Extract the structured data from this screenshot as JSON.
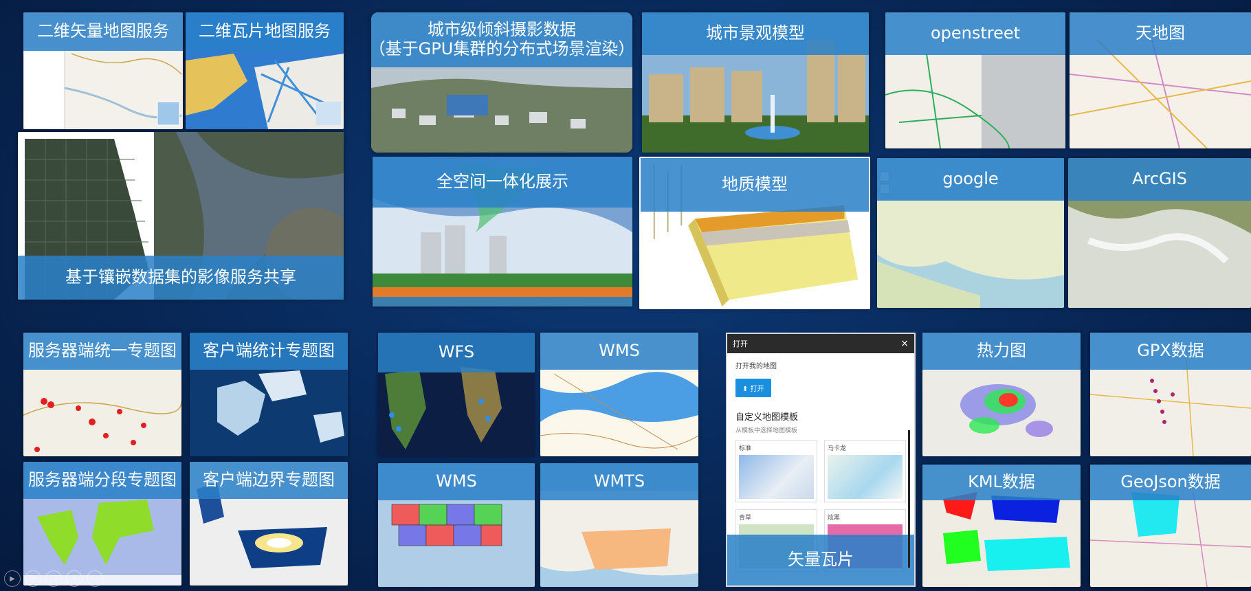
{
  "tiles": {
    "vector2d": "二维矢量地图服务",
    "tile2d": "二维瓦片地图服务",
    "mosaic": "基于镶嵌数据集的影像服务共享",
    "oblique_line1": "城市级倾斜摄影数据",
    "oblique_line2": "（基于GPU集群的分布式场景渲染）",
    "landscape": "城市景观模型",
    "openstreet": "openstreet",
    "tianditu": "天地图",
    "fullspace": "全空间一体化展示",
    "geology": "地质模型",
    "google": "google",
    "arcgis": "ArcGIS",
    "server_unified": "服务器端统一专题图",
    "client_stat": "客户端统计专题图",
    "wfs": "WFS",
    "wms_a": "WMS",
    "server_segment": "服务器端分段专题图",
    "client_border": "客户端边界专题图",
    "wms_b": "WMS",
    "wmts": "WMTS",
    "vector_tile": "矢量瓦片",
    "heatmap": "热力图",
    "gpx": "GPX数据",
    "kml": "KML数据",
    "geojson": "GeoJson数据"
  },
  "dialog": {
    "title": "打开",
    "close": "×",
    "recent": "打开我的地图",
    "open_btn": "打开",
    "template_title": "自定义地图模板",
    "template_hint": "从模板中选择地图模板",
    "card1": "标准",
    "card2": "马卡龙",
    "card3": "青草",
    "card4": "炫黑"
  },
  "icons": {
    "player": [
      "play-icon",
      "pen-icon",
      "copy-icon",
      "zoom-icon",
      "more-icon"
    ]
  },
  "colors": {
    "banner": "#2a80c8",
    "background": "#082a5c"
  }
}
